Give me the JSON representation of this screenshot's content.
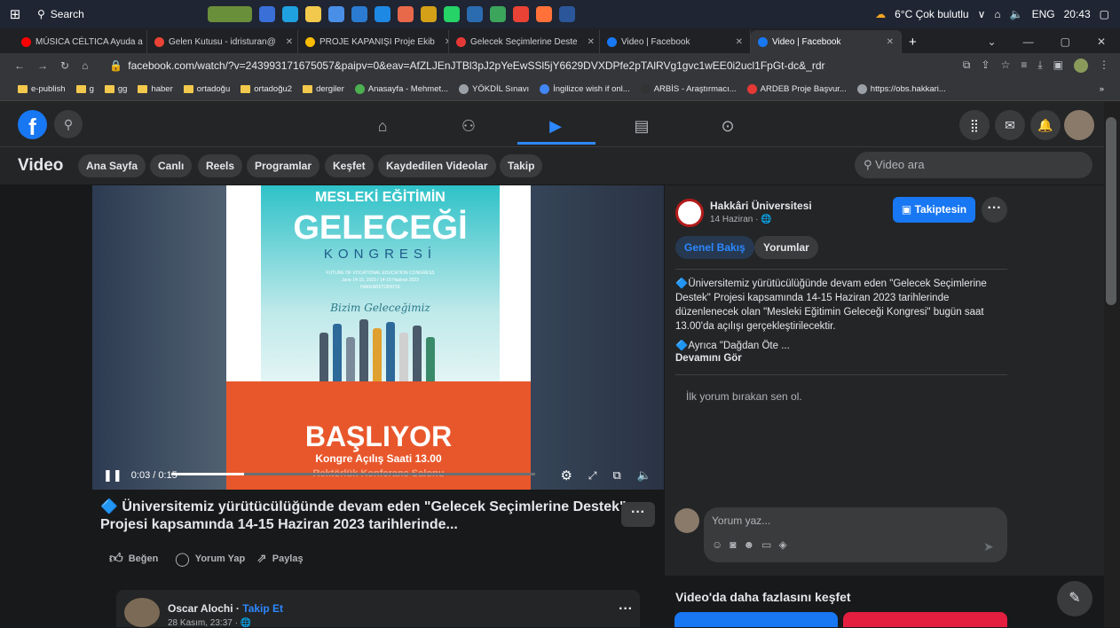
{
  "taskbar": {
    "search_label": "Search",
    "weather": "6°C  Çok bulutlu",
    "language": "ENG",
    "time": "20:43"
  },
  "tabs": [
    {
      "label": "MÚSICA CÉLTICA Ayuda a",
      "color": "#ff0000"
    },
    {
      "label": "Gelen Kutusu - idristuran@",
      "color": "#ea4335"
    },
    {
      "label": "PROJE KAPANIŞI Proje Ekib",
      "color": "#fbbc04"
    },
    {
      "label": "Gelecek Seçimlerine Deste",
      "color": "#e53935"
    },
    {
      "label": "Video | Facebook",
      "color": "#1877f2"
    },
    {
      "label": "Video | Facebook",
      "color": "#1877f2"
    }
  ],
  "address": {
    "url": "facebook.com/watch/?v=243993171675057&paipv=0&eav=AfZLJEnJTBl3pJ2pYeEwSSl5jY6629DVXDPfe2pTAlRVg1gvc1wEE0i2ucl1FpGt-dc&_rdr"
  },
  "bookmarks": [
    {
      "label": "e-publish"
    },
    {
      "label": "g"
    },
    {
      "label": "gg"
    },
    {
      "label": "haber"
    },
    {
      "label": "ortadoğu"
    },
    {
      "label": "ortadoğu2"
    },
    {
      "label": "dergiler"
    },
    {
      "label": "Anasayfa - Mehmet..."
    },
    {
      "label": "YÖKDİL Sınavı"
    },
    {
      "label": "İngilizce wish if onl..."
    },
    {
      "label": "ARBİS - Araştırmacı..."
    },
    {
      "label": "ARDEB Proje Başvur..."
    },
    {
      "label": "https://obs.hakkari..."
    }
  ],
  "subnav": {
    "title": "Video",
    "pills": [
      "Ana Sayfa",
      "Canlı",
      "Reels",
      "Programlar",
      "Keşfet",
      "Kaydedilen Videolar",
      "Takip"
    ],
    "search_placeholder": "Video ara"
  },
  "video": {
    "poster_line1": "MESLEKİ EĞİTİMİN",
    "poster_line2": "GELECEĞİ",
    "poster_line3": "KONGRESİ",
    "poster_sub1": "FUTURE OF VOCATIONAL EDUCATION CONGRESS",
    "poster_sub2": "June 14-15, 2023 / 14-15 Haziran 2023",
    "poster_sub3": "HAKKARİ/TÜRKİYE",
    "poster_script": "Bizim Geleceğimiz",
    "poster_banner": "BAŞLIYOR",
    "poster_banner2": "Kongre Açılış Saati 13.00",
    "poster_banner3": "Rektörlük Konferans Salonu",
    "time": "0:03 / 0:15",
    "progress": 0.2,
    "caption": "🔷 Üniversitemiz yürütücülüğünde devam eden \"Gelecek Seçimlerine Destek\" Projesi kapsamında 14-15 Haziran 2023 tarihlerinde...",
    "more": "···"
  },
  "actions": {
    "like": "Beğen",
    "comment": "Yorum Yap",
    "share": "Paylaş"
  },
  "post": {
    "page_name": "Hakkâri Üniversitesi",
    "date": "14 Haziran · 🌐",
    "follow_label": "Takiptesin",
    "more": "···",
    "tab_overview": "Genel Bakış",
    "tab_comments": "Yorumlar",
    "description": "🔷Üniversitemiz yürütücülüğünde devam eden \"Gelecek Seçimlerine Destek\" Projesi kapsamında 14-15 Haziran 2023 tarihlerinde düzenlenecek olan \"Mesleki Eğitimin Geleceği Kongresi\" bugün saat 13.00'da açılışı gerçekleştirilecektir.",
    "description2": "🔷Ayrıca \"Dağdan Öte ...",
    "see_more": "Devamını Gör",
    "first_comment": "İlk yorum bırakan sen ol.",
    "comment_placeholder": "Yorum yaz..."
  },
  "lower": {
    "commenter_name": "Oscar Alochi",
    "follow_link": "Takip Et",
    "commenter_date": "28 Kasım, 23:37 · 🌐",
    "more": "···",
    "explore_title": "Video'da daha fazlasını keşfet"
  },
  "colors": {
    "accent": "#1877f2",
    "background": "#18191a",
    "surface": "#242526"
  }
}
